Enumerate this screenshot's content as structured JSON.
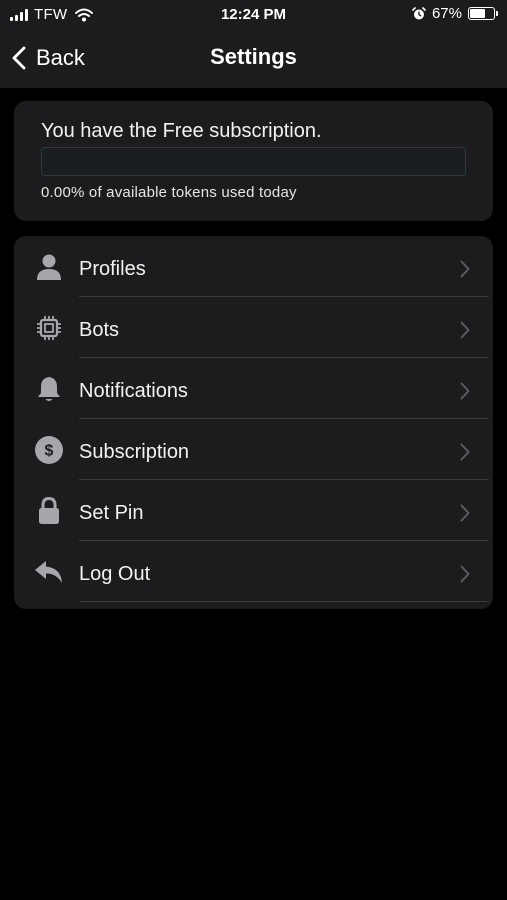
{
  "status_bar": {
    "carrier": "TFW",
    "time": "12:24 PM",
    "battery_percent": "67%",
    "battery_level": 0.67,
    "icons": [
      "cellular-signal-icon",
      "wifi-icon",
      "alarm-icon",
      "battery-icon"
    ]
  },
  "nav": {
    "back_label": "Back",
    "title": "Settings"
  },
  "subscription": {
    "status_text": "You have the Free subscription.",
    "usage_text": "0.00% of available tokens used today",
    "usage_fraction": 0.0
  },
  "settings": {
    "items": [
      {
        "label": "Profiles",
        "icon": "person-icon"
      },
      {
        "label": "Bots",
        "icon": "chip-icon"
      },
      {
        "label": "Notifications",
        "icon": "bell-icon"
      },
      {
        "label": "Subscription",
        "icon": "dollar-icon"
      },
      {
        "label": "Set Pin",
        "icon": "lock-icon"
      },
      {
        "label": "Log Out",
        "icon": "reply-arrow-icon"
      }
    ]
  },
  "colors": {
    "background": "#000000",
    "card": "#1c1c1e",
    "icon_gray": "#a7a7ab",
    "chevron_gray": "#5c5c60",
    "progress_border": "#1f3f49"
  }
}
